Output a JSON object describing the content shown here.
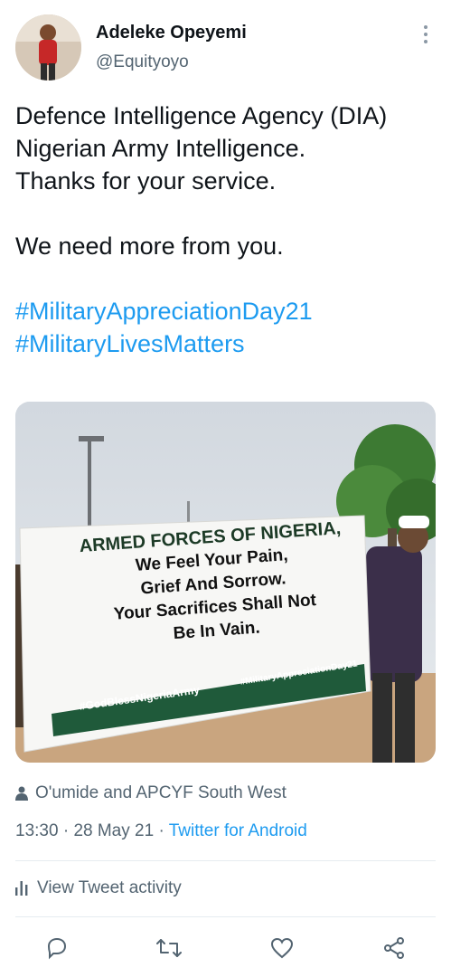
{
  "author": {
    "name": "Adeleke Opeyemi",
    "handle": "@Equityoyo"
  },
  "tweet": {
    "lines": [
      "Defence Intelligence Agency (DIA)",
      "Nigerian Army Intelligence.",
      "Thanks for your service.",
      "",
      "We need more from you.",
      ""
    ],
    "hashtags": [
      "#MilitaryAppreciationDay21",
      "#MilitaryLivesMatters"
    ]
  },
  "media": {
    "banner_lines": [
      "ARMED FORCES OF NIGERIA,",
      "We Feel Your Pain,",
      "Grief And Sorrow.",
      "Your Sacrifices Shall Not",
      "Be In Vain."
    ],
    "banner_tag_left": "#GodBlessNigeriaArmy",
    "banner_tag_right": "#MilitaryAppreciationDay21"
  },
  "attribution": "O'umide and APCYF South West",
  "meta": {
    "time": "13:30",
    "separator": "·",
    "date": "28 May 21",
    "source": "Twitter for Android"
  },
  "activity_label": "View Tweet activity",
  "icons": {
    "more": "more-vertical-icon",
    "person": "person-icon",
    "activity": "bar-chart-icon",
    "reply": "reply-icon",
    "retweet": "retweet-icon",
    "like": "heart-icon",
    "share": "share-icon"
  },
  "colors": {
    "link": "#1d9bf0",
    "secondary_text": "#536471",
    "banner_text": "#1c3a26",
    "banner_strip": "#1f5a3a"
  }
}
